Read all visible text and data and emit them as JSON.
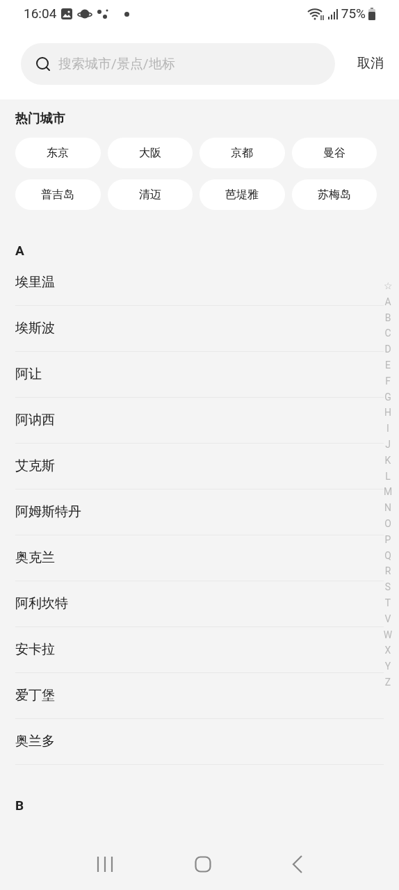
{
  "status_bar": {
    "time": "16:04",
    "battery": "75%"
  },
  "search": {
    "placeholder": "搜索城市/景点/地标",
    "cancel": "取消"
  },
  "hot_cities": {
    "title": "热门城市",
    "items": [
      "东京",
      "大阪",
      "京都",
      "曼谷",
      "普吉岛",
      "清迈",
      "芭堤雅",
      "苏梅岛"
    ]
  },
  "sections": [
    {
      "letter": "A",
      "cities": [
        "埃里温",
        "埃斯波",
        "阿让",
        "阿讷西",
        "艾克斯",
        "阿姆斯特丹",
        "奥克兰",
        "阿利坎特",
        "安卡拉",
        "爱丁堡",
        "奥兰多"
      ]
    },
    {
      "letter": "B"
    }
  ],
  "index_bar": [
    "☆",
    "A",
    "B",
    "C",
    "D",
    "E",
    "F",
    "G",
    "H",
    "I",
    "J",
    "K",
    "L",
    "M",
    "N",
    "O",
    "P",
    "Q",
    "R",
    "S",
    "T",
    "V",
    "W",
    "X",
    "Y",
    "Z"
  ]
}
